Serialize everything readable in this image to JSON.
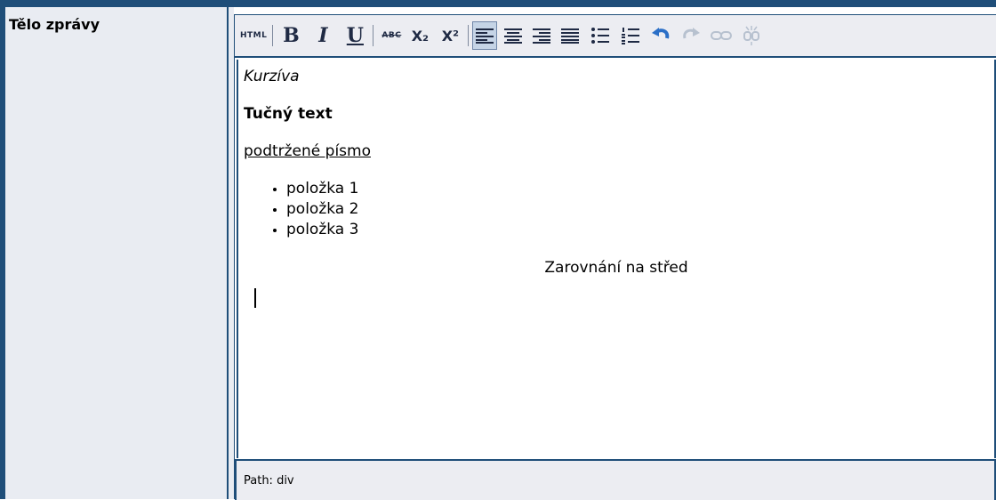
{
  "form": {
    "field_label": "Tělo zprávy"
  },
  "toolbar": {
    "html_label": "HTML",
    "bold_label": "B",
    "italic_label": "I",
    "underline_label": "U",
    "strikethrough_label": "ABC",
    "subscript_label": "X₂",
    "superscript_label": "X²",
    "icons": [
      "html-source-icon",
      "bold-icon",
      "italic-icon",
      "underline-icon",
      "strikethrough-icon",
      "subscript-icon",
      "superscript-icon",
      "align-left-icon",
      "align-center-icon",
      "align-right-icon",
      "align-justify-icon",
      "bullet-list-icon",
      "numbered-list-icon",
      "undo-icon",
      "redo-icon",
      "link-icon",
      "unlink-icon"
    ]
  },
  "content": {
    "italic_text": "Kurzíva",
    "bold_text": "Tučný text",
    "underline_text": "podtržené písmo",
    "list_items": [
      "položka 1",
      "položka 2",
      "položka 3"
    ],
    "center_text": "Zarovnání na střed"
  },
  "status": {
    "path_text": "Path: div"
  },
  "colors": {
    "border": "#1f4e79",
    "panel": "#ecedf2",
    "active": "#c5d4e6",
    "undo": "#2b6fc7",
    "disabled": "#b7c1cf"
  }
}
